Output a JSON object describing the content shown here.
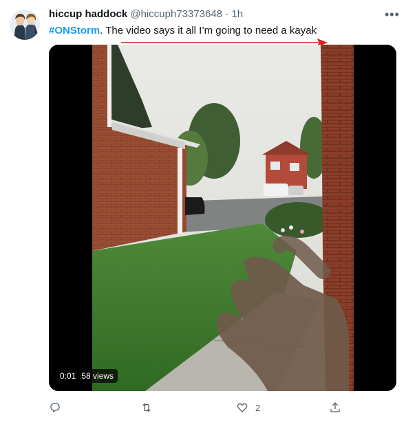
{
  "tweet": {
    "display_name": "hiccup haddock",
    "handle": "@hiccuph73373648",
    "separator": "·",
    "time": "1h",
    "hashtag": "#ONStorm",
    "text": ". The video says it all I’m going to need a kayak"
  },
  "media": {
    "elapsed": "0:01",
    "views": "58 views"
  },
  "actions": {
    "reply_count": "",
    "retweet_count": "",
    "like_count": "2"
  },
  "icons": {
    "more": "more-horizontal-icon",
    "reply": "reply-icon",
    "retweet": "retweet-icon",
    "like": "heart-icon",
    "share": "share-icon"
  },
  "colors": {
    "accent": "#1d9bf0",
    "muted": "#536471",
    "annotation_arrow": "#e0201c"
  }
}
